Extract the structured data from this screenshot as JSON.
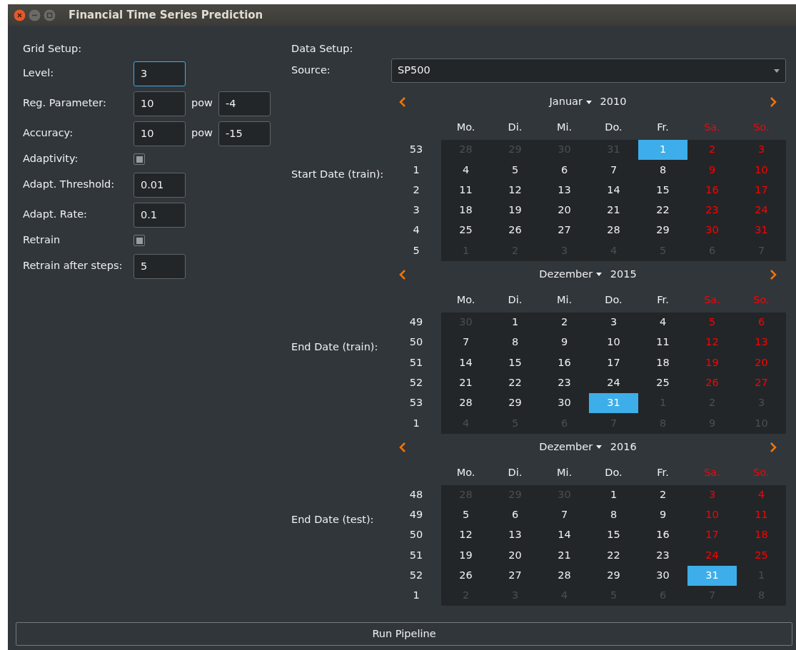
{
  "window": {
    "title": "Financial Time Series Prediction"
  },
  "grid_setup": {
    "heading": "Grid Setup:",
    "rows": [
      {
        "kind": "field",
        "label": "Level:",
        "value": "3",
        "focused": true
      },
      {
        "kind": "pow",
        "label": "Reg. Parameter:",
        "value": "10",
        "pow_label": "pow",
        "exponent": "-4"
      },
      {
        "kind": "pow",
        "label": "Accuracy:",
        "value": "10",
        "pow_label": "pow",
        "exponent": "-15"
      },
      {
        "kind": "checkbox",
        "label": "Adaptivity:",
        "checked": false
      },
      {
        "kind": "field",
        "label": "Adapt. Threshold:",
        "value": "0.01",
        "focused": false
      },
      {
        "kind": "field",
        "label": "Adapt. Rate:",
        "value": "0.1",
        "focused": false
      },
      {
        "kind": "checkbox",
        "label": "Retrain",
        "checked": false
      },
      {
        "kind": "field",
        "label": "Retrain after steps:",
        "value": "5",
        "focused": false
      }
    ]
  },
  "data_setup": {
    "heading": "Data Setup:",
    "source_label": "Source:",
    "source": "SP500",
    "calendars": [
      {
        "label": "Start Date (train):",
        "month": "Januar",
        "year": "2010",
        "weekdays": [
          {
            "text": "Mo.",
            "weekend": false
          },
          {
            "text": "Di.",
            "weekend": false
          },
          {
            "text": "Mi.",
            "weekend": false
          },
          {
            "text": "Do.",
            "weekend": false
          },
          {
            "text": "Fr.",
            "weekend": false
          },
          {
            "text": "Sa.",
            "weekend": true
          },
          {
            "text": "So.",
            "weekend": true
          }
        ],
        "weeks": [
          {
            "week": "53",
            "days": [
              {
                "day": "28",
                "other_month": true,
                "selected": false
              },
              {
                "day": "29",
                "other_month": true,
                "selected": false
              },
              {
                "day": "30",
                "other_month": true,
                "selected": false
              },
              {
                "day": "31",
                "other_month": true,
                "selected": false
              },
              {
                "day": "1",
                "other_month": false,
                "selected": true
              },
              {
                "day": "2",
                "other_month": false,
                "selected": false
              },
              {
                "day": "3",
                "other_month": false,
                "selected": false
              }
            ]
          },
          {
            "week": "1",
            "days": [
              {
                "day": "4",
                "other_month": false,
                "selected": false
              },
              {
                "day": "5",
                "other_month": false,
                "selected": false
              },
              {
                "day": "6",
                "other_month": false,
                "selected": false
              },
              {
                "day": "7",
                "other_month": false,
                "selected": false
              },
              {
                "day": "8",
                "other_month": false,
                "selected": false
              },
              {
                "day": "9",
                "other_month": false,
                "selected": false
              },
              {
                "day": "10",
                "other_month": false,
                "selected": false
              }
            ]
          },
          {
            "week": "2",
            "days": [
              {
                "day": "11",
                "other_month": false,
                "selected": false
              },
              {
                "day": "12",
                "other_month": false,
                "selected": false
              },
              {
                "day": "13",
                "other_month": false,
                "selected": false
              },
              {
                "day": "14",
                "other_month": false,
                "selected": false
              },
              {
                "day": "15",
                "other_month": false,
                "selected": false
              },
              {
                "day": "16",
                "other_month": false,
                "selected": false
              },
              {
                "day": "17",
                "other_month": false,
                "selected": false
              }
            ]
          },
          {
            "week": "3",
            "days": [
              {
                "day": "18",
                "other_month": false,
                "selected": false
              },
              {
                "day": "19",
                "other_month": false,
                "selected": false
              },
              {
                "day": "20",
                "other_month": false,
                "selected": false
              },
              {
                "day": "21",
                "other_month": false,
                "selected": false
              },
              {
                "day": "22",
                "other_month": false,
                "selected": false
              },
              {
                "day": "23",
                "other_month": false,
                "selected": false
              },
              {
                "day": "24",
                "other_month": false,
                "selected": false
              }
            ]
          },
          {
            "week": "4",
            "days": [
              {
                "day": "25",
                "other_month": false,
                "selected": false
              },
              {
                "day": "26",
                "other_month": false,
                "selected": false
              },
              {
                "day": "27",
                "other_month": false,
                "selected": false
              },
              {
                "day": "28",
                "other_month": false,
                "selected": false
              },
              {
                "day": "29",
                "other_month": false,
                "selected": false
              },
              {
                "day": "30",
                "other_month": false,
                "selected": false
              },
              {
                "day": "31",
                "other_month": false,
                "selected": false
              }
            ]
          },
          {
            "week": "5",
            "days": [
              {
                "day": "1",
                "other_month": true,
                "selected": false
              },
              {
                "day": "2",
                "other_month": true,
                "selected": false
              },
              {
                "day": "3",
                "other_month": true,
                "selected": false
              },
              {
                "day": "4",
                "other_month": true,
                "selected": false
              },
              {
                "day": "5",
                "other_month": true,
                "selected": false
              },
              {
                "day": "6",
                "other_month": true,
                "selected": false
              },
              {
                "day": "7",
                "other_month": true,
                "selected": false
              }
            ]
          }
        ]
      },
      {
        "label": "End Date (train):",
        "month": "Dezember",
        "year": "2015",
        "weekdays": [
          {
            "text": "Mo.",
            "weekend": false
          },
          {
            "text": "Di.",
            "weekend": false
          },
          {
            "text": "Mi.",
            "weekend": false
          },
          {
            "text": "Do.",
            "weekend": false
          },
          {
            "text": "Fr.",
            "weekend": false
          },
          {
            "text": "Sa.",
            "weekend": true
          },
          {
            "text": "So.",
            "weekend": true
          }
        ],
        "weeks": [
          {
            "week": "49",
            "days": [
              {
                "day": "30",
                "other_month": true,
                "selected": false
              },
              {
                "day": "1",
                "other_month": false,
                "selected": false
              },
              {
                "day": "2",
                "other_month": false,
                "selected": false
              },
              {
                "day": "3",
                "other_month": false,
                "selected": false
              },
              {
                "day": "4",
                "other_month": false,
                "selected": false
              },
              {
                "day": "5",
                "other_month": false,
                "selected": false
              },
              {
                "day": "6",
                "other_month": false,
                "selected": false
              }
            ]
          },
          {
            "week": "50",
            "days": [
              {
                "day": "7",
                "other_month": false,
                "selected": false
              },
              {
                "day": "8",
                "other_month": false,
                "selected": false
              },
              {
                "day": "9",
                "other_month": false,
                "selected": false
              },
              {
                "day": "10",
                "other_month": false,
                "selected": false
              },
              {
                "day": "11",
                "other_month": false,
                "selected": false
              },
              {
                "day": "12",
                "other_month": false,
                "selected": false
              },
              {
                "day": "13",
                "other_month": false,
                "selected": false
              }
            ]
          },
          {
            "week": "51",
            "days": [
              {
                "day": "14",
                "other_month": false,
                "selected": false
              },
              {
                "day": "15",
                "other_month": false,
                "selected": false
              },
              {
                "day": "16",
                "other_month": false,
                "selected": false
              },
              {
                "day": "17",
                "other_month": false,
                "selected": false
              },
              {
                "day": "18",
                "other_month": false,
                "selected": false
              },
              {
                "day": "19",
                "other_month": false,
                "selected": false
              },
              {
                "day": "20",
                "other_month": false,
                "selected": false
              }
            ]
          },
          {
            "week": "52",
            "days": [
              {
                "day": "21",
                "other_month": false,
                "selected": false
              },
              {
                "day": "22",
                "other_month": false,
                "selected": false
              },
              {
                "day": "23",
                "other_month": false,
                "selected": false
              },
              {
                "day": "24",
                "other_month": false,
                "selected": false
              },
              {
                "day": "25",
                "other_month": false,
                "selected": false
              },
              {
                "day": "26",
                "other_month": false,
                "selected": false
              },
              {
                "day": "27",
                "other_month": false,
                "selected": false
              }
            ]
          },
          {
            "week": "53",
            "days": [
              {
                "day": "28",
                "other_month": false,
                "selected": false
              },
              {
                "day": "29",
                "other_month": false,
                "selected": false
              },
              {
                "day": "30",
                "other_month": false,
                "selected": false
              },
              {
                "day": "31",
                "other_month": false,
                "selected": true
              },
              {
                "day": "1",
                "other_month": true,
                "selected": false
              },
              {
                "day": "2",
                "other_month": true,
                "selected": false
              },
              {
                "day": "3",
                "other_month": true,
                "selected": false
              }
            ]
          },
          {
            "week": "1",
            "days": [
              {
                "day": "4",
                "other_month": true,
                "selected": false
              },
              {
                "day": "5",
                "other_month": true,
                "selected": false
              },
              {
                "day": "6",
                "other_month": true,
                "selected": false
              },
              {
                "day": "7",
                "other_month": true,
                "selected": false
              },
              {
                "day": "8",
                "other_month": true,
                "selected": false
              },
              {
                "day": "9",
                "other_month": true,
                "selected": false
              },
              {
                "day": "10",
                "other_month": true,
                "selected": false
              }
            ]
          }
        ]
      },
      {
        "label": "End Date (test):",
        "month": "Dezember",
        "year": "2016",
        "weekdays": [
          {
            "text": "Mo.",
            "weekend": false
          },
          {
            "text": "Di.",
            "weekend": false
          },
          {
            "text": "Mi.",
            "weekend": false
          },
          {
            "text": "Do.",
            "weekend": false
          },
          {
            "text": "Fr.",
            "weekend": false
          },
          {
            "text": "Sa.",
            "weekend": true
          },
          {
            "text": "So.",
            "weekend": true
          }
        ],
        "weeks": [
          {
            "week": "48",
            "days": [
              {
                "day": "28",
                "other_month": true,
                "selected": false
              },
              {
                "day": "29",
                "other_month": true,
                "selected": false
              },
              {
                "day": "30",
                "other_month": true,
                "selected": false
              },
              {
                "day": "1",
                "other_month": false,
                "selected": false
              },
              {
                "day": "2",
                "other_month": false,
                "selected": false
              },
              {
                "day": "3",
                "other_month": false,
                "selected": false
              },
              {
                "day": "4",
                "other_month": false,
                "selected": false
              }
            ]
          },
          {
            "week": "49",
            "days": [
              {
                "day": "5",
                "other_month": false,
                "selected": false
              },
              {
                "day": "6",
                "other_month": false,
                "selected": false
              },
              {
                "day": "7",
                "other_month": false,
                "selected": false
              },
              {
                "day": "8",
                "other_month": false,
                "selected": false
              },
              {
                "day": "9",
                "other_month": false,
                "selected": false
              },
              {
                "day": "10",
                "other_month": false,
                "selected": false
              },
              {
                "day": "11",
                "other_month": false,
                "selected": false
              }
            ]
          },
          {
            "week": "50",
            "days": [
              {
                "day": "12",
                "other_month": false,
                "selected": false
              },
              {
                "day": "13",
                "other_month": false,
                "selected": false
              },
              {
                "day": "14",
                "other_month": false,
                "selected": false
              },
              {
                "day": "15",
                "other_month": false,
                "selected": false
              },
              {
                "day": "16",
                "other_month": false,
                "selected": false
              },
              {
                "day": "17",
                "other_month": false,
                "selected": false
              },
              {
                "day": "18",
                "other_month": false,
                "selected": false
              }
            ]
          },
          {
            "week": "51",
            "days": [
              {
                "day": "19",
                "other_month": false,
                "selected": false
              },
              {
                "day": "20",
                "other_month": false,
                "selected": false
              },
              {
                "day": "21",
                "other_month": false,
                "selected": false
              },
              {
                "day": "22",
                "other_month": false,
                "selected": false
              },
              {
                "day": "23",
                "other_month": false,
                "selected": false
              },
              {
                "day": "24",
                "other_month": false,
                "selected": false
              },
              {
                "day": "25",
                "other_month": false,
                "selected": false
              }
            ]
          },
          {
            "week": "52",
            "days": [
              {
                "day": "26",
                "other_month": false,
                "selected": false
              },
              {
                "day": "27",
                "other_month": false,
                "selected": false
              },
              {
                "day": "28",
                "other_month": false,
                "selected": false
              },
              {
                "day": "29",
                "other_month": false,
                "selected": false
              },
              {
                "day": "30",
                "other_month": false,
                "selected": false
              },
              {
                "day": "31",
                "other_month": false,
                "selected": true
              },
              {
                "day": "1",
                "other_month": true,
                "selected": false
              }
            ]
          },
          {
            "week": "1",
            "days": [
              {
                "day": "2",
                "other_month": true,
                "selected": false
              },
              {
                "day": "3",
                "other_month": true,
                "selected": false
              },
              {
                "day": "4",
                "other_month": true,
                "selected": false
              },
              {
                "day": "5",
                "other_month": true,
                "selected": false
              },
              {
                "day": "6",
                "other_month": true,
                "selected": false
              },
              {
                "day": "7",
                "other_month": true,
                "selected": false
              },
              {
                "day": "8",
                "other_month": true,
                "selected": false
              }
            ]
          }
        ]
      }
    ]
  },
  "run_button": "Run Pipeline"
}
